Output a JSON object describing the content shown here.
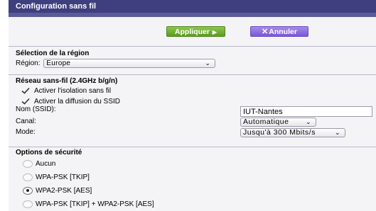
{
  "window": {
    "title": "Configuration sans fil"
  },
  "toolbar": {
    "apply_label": "Appliquer",
    "cancel_label": "Annuler"
  },
  "region": {
    "title": "Sélection de la région",
    "label": "Région:",
    "value": "Europe"
  },
  "wireless": {
    "title": "Réseau sans-fil (2.4GHz b/g/n)",
    "isolation_label": "Activer l'isolation sans fil",
    "isolation_checked": true,
    "broadcast_label": "Activer la diffusion du SSID",
    "broadcast_checked": true,
    "ssid_label": "Nom (SSID):",
    "ssid_value": "IUT-Nantes",
    "channel_label": "Canal:",
    "channel_value": "Automatique",
    "mode_label": "Mode:",
    "mode_value": "Jusqu'à 300 Mbits/s"
  },
  "security": {
    "title": "Options de sécurité",
    "options": [
      {
        "label": "Aucun",
        "selected": false
      },
      {
        "label": "WPA-PSK [TKIP]",
        "selected": false
      },
      {
        "label": "WPA2-PSK [AES]",
        "selected": true
      },
      {
        "label": "WPA-PSK [TKIP] + WPA2-PSK [AES]",
        "selected": false
      }
    ]
  },
  "colors": {
    "titlebar": "#3f3f7f",
    "apply_button": "#6fae2e",
    "cancel_button": "#8a68df"
  }
}
